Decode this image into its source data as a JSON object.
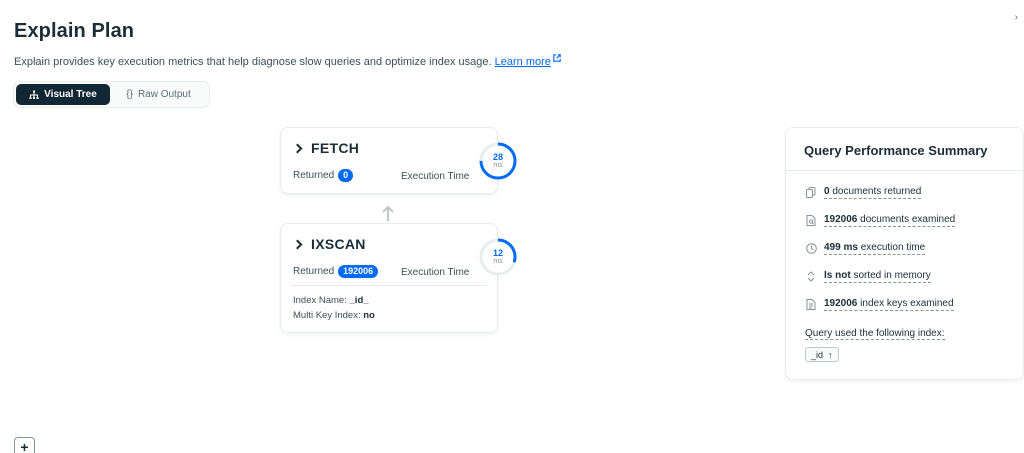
{
  "header": {
    "title": "Explain Plan",
    "description": "Explain provides key execution metrics that help diagnose slow queries and optimize index usage.",
    "learn_more": "Learn more",
    "close_icon": "close-icon"
  },
  "view_toggle": {
    "visual_tree": "Visual Tree",
    "raw_output": "Raw Output",
    "selected": "Visual Tree"
  },
  "stages": [
    {
      "name": "FETCH",
      "returned_label": "Returned",
      "returned": "0",
      "exec_label": "Execution Time",
      "exec_value": "28",
      "exec_unit": "ms",
      "exec_fraction": 0.75
    },
    {
      "name": "IXSCAN",
      "returned_label": "Returned",
      "returned": "192006",
      "exec_label": "Execution Time",
      "exec_value": "12",
      "exec_unit": "ms",
      "exec_fraction": 0.3,
      "index_name_label": "Index Name:",
      "index_name": "_id_",
      "multi_key_label": "Multi Key Index:",
      "multi_key": "no"
    }
  ],
  "summary": {
    "title": "Query Performance Summary",
    "items": [
      {
        "icon": "documents-icon",
        "value": "0",
        "text": "documents returned"
      },
      {
        "icon": "document-search-icon",
        "value": "192006",
        "text": "documents examined"
      },
      {
        "icon": "clock-icon",
        "value": "499 ms",
        "text": "execution time"
      },
      {
        "icon": "sort-icon",
        "value": "Is not",
        "text": "sorted in memory"
      },
      {
        "icon": "index-keys-icon",
        "value": "192006",
        "text": "index keys examined"
      }
    ],
    "index_label": "Query used the following index:",
    "index_chip": "_id"
  },
  "colors": {
    "accent": "#016bf8",
    "dark": "#112733"
  },
  "zoom": {
    "plus": "+"
  }
}
